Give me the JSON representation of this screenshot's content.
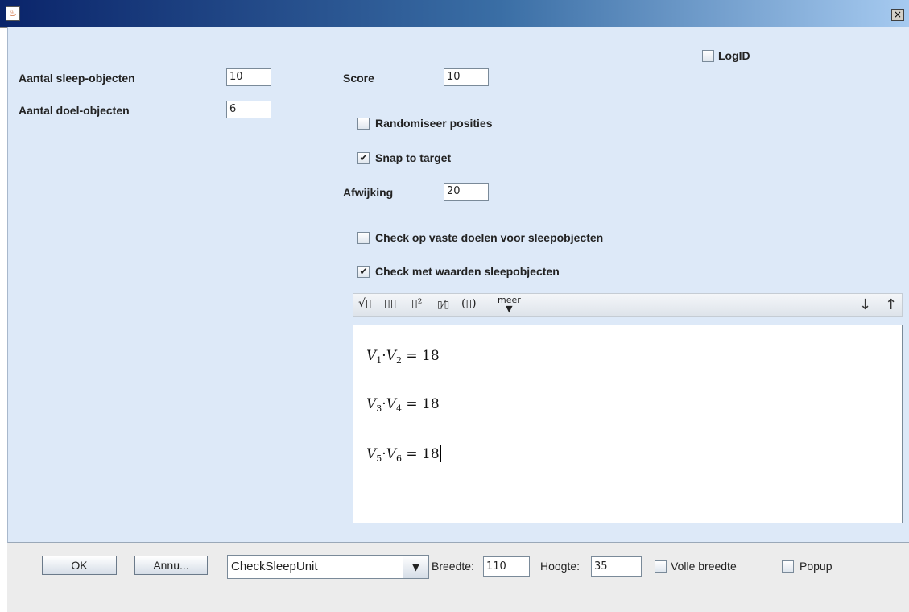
{
  "window": {
    "icon": "java-cup-icon",
    "close_glyph": "×"
  },
  "form": {
    "sleep_label": "Aantal sleep-objecten",
    "sleep_value": "10",
    "doel_label": "Aantal doel-objecten",
    "doel_value": "6",
    "score_label": "Score",
    "score_value": "10",
    "logid_label": "LogID",
    "logid_checked": false,
    "randomize_label": "Randomiseer posities",
    "randomize_checked": false,
    "snap_label": "Snap to target",
    "snap_checked": true,
    "afwijking_label": "Afwijking",
    "afwijking_value": "20",
    "check_vaste_label": "Check op vaste doelen voor sleepobjecten",
    "check_vaste_checked": false,
    "check_waarden_label": "Check met waarden sleepobjecten",
    "check_waarden_checked": true
  },
  "toolbar": {
    "sqrt": "√▯",
    "subscript": "▯▯",
    "power": "▯²",
    "fraction": "▯⁄▯",
    "parens": "(▯)",
    "meer_label": "meer",
    "meer_arrow": "▼",
    "down_arrow": "↓",
    "up_arrow": "↑"
  },
  "equations": [
    {
      "a": "V",
      "a_sub": "1",
      "b": "V",
      "b_sub": "2",
      "rhs": "= 18"
    },
    {
      "a": "V",
      "a_sub": "3",
      "b": "V",
      "b_sub": "4",
      "rhs": "= 18"
    },
    {
      "a": "V",
      "a_sub": "5",
      "b": "V",
      "b_sub": "6",
      "rhs": "= 18"
    }
  ],
  "bottom": {
    "ok_label": "OK",
    "cancel_label": "Annu...",
    "unit_value": "CheckSleepUnit",
    "combo_arrow": "▼",
    "breedte_label": "Breedte:",
    "breedte_value": "110",
    "hoogte_label": "Hoogte:",
    "hoogte_value": "35",
    "volle_breedte_label": "Volle breedte",
    "volle_breedte_checked": false,
    "popup_label": "Popup",
    "popup_checked": false
  }
}
